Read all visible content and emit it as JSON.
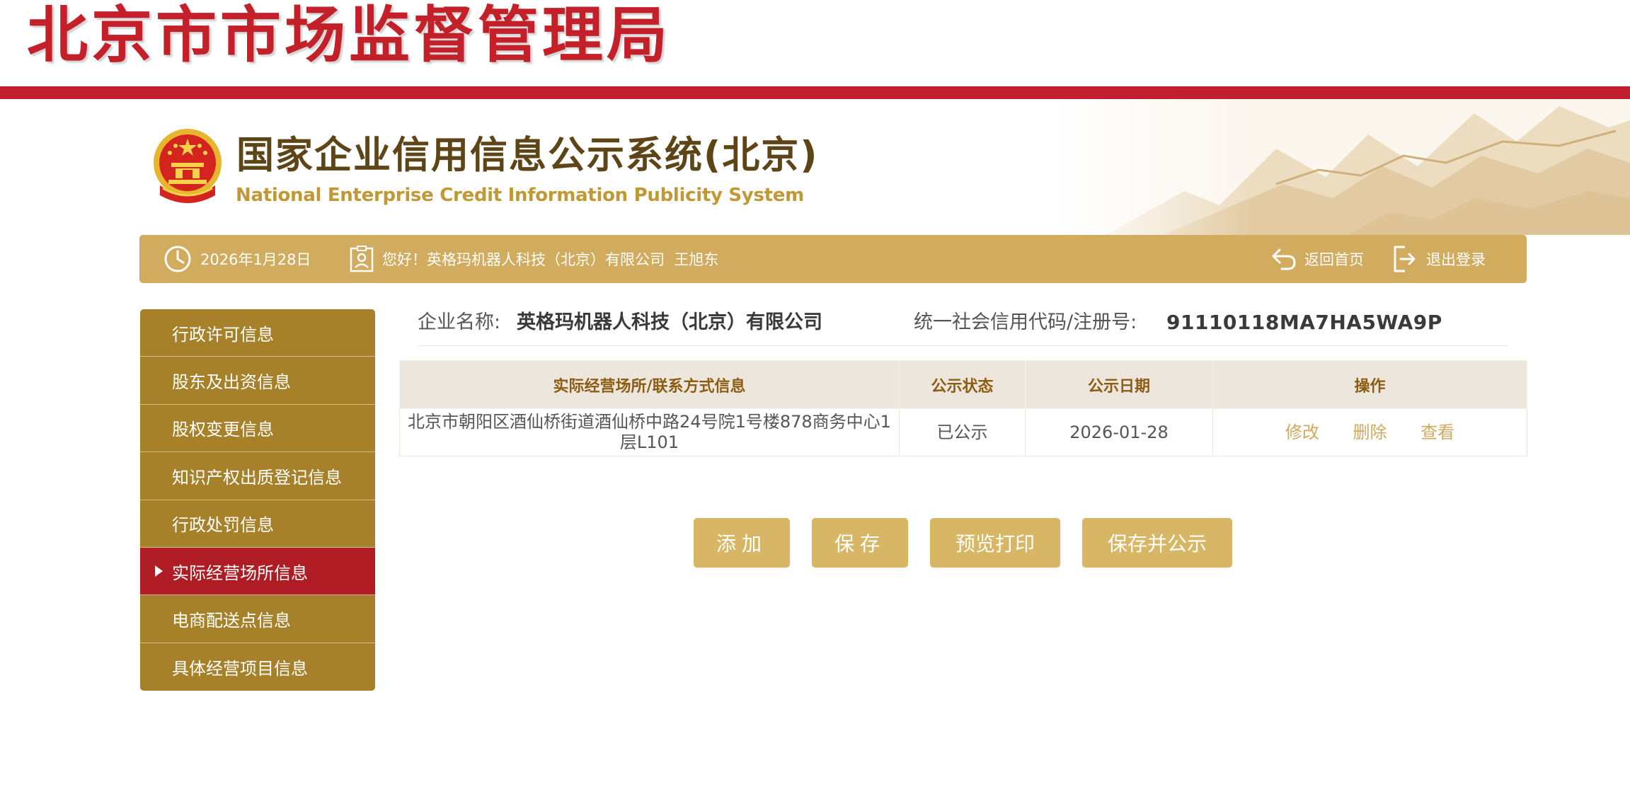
{
  "banner": {
    "title": "北京市市场监督管理局"
  },
  "system": {
    "title_cn": "国家企业信用信息公示系统(北京)",
    "title_en": "National Enterprise Credit Information Publicity System"
  },
  "info_bar": {
    "date": "2026年1月28日",
    "greeting": "您好！英格玛机器人科技（北京）有限公司  王旭东",
    "home_label": "返回首页",
    "logout_label": "退出登录"
  },
  "sidebar": {
    "items": [
      {
        "label": "行政许可信息",
        "active": false
      },
      {
        "label": "股东及出资信息",
        "active": false
      },
      {
        "label": "股权变更信息",
        "active": false
      },
      {
        "label": "知识产权出质登记信息",
        "active": false
      },
      {
        "label": "行政处罚信息",
        "active": false
      },
      {
        "label": "实际经营场所信息",
        "active": true
      },
      {
        "label": "电商配送点信息",
        "active": false
      },
      {
        "label": "具体经营项目信息",
        "active": false
      }
    ]
  },
  "company": {
    "name_label": "企业名称:",
    "name": "英格玛机器人科技（北京）有限公司",
    "credit_label": "统一社会信用代码/注册号:",
    "credit_code": "91110118MA7HA5WA9P"
  },
  "table": {
    "headers": [
      "实际经营场所/联系方式信息",
      "公示状态",
      "公示日期",
      "操作"
    ],
    "rows": [
      {
        "address_line1": "北京市朝阳区酒仙桥街道酒仙桥中路24号院1号楼878商务中心1",
        "address_line2": "层L101",
        "status": "已公示",
        "date": "2026-01-28",
        "actions": [
          "修改",
          "删除",
          "查看"
        ]
      }
    ]
  },
  "buttons": {
    "add": "添加",
    "save": "保存",
    "preview_print": "预览打印",
    "save_publish": "保存并公示"
  },
  "colors": {
    "banner_red": "#c4202a",
    "gold_bar": "#d1ab5e",
    "sidebar_bg": "#a7812a",
    "sidebar_active": "#b01c23",
    "button_gold": "#d7b766",
    "header_brown": "#8b5d12"
  },
  "icons": {
    "date": "clock-icon",
    "greeting": "user-card-icon",
    "home": "return-arrow-icon",
    "logout": "logout-icon",
    "emblem": "national-emblem-icon",
    "active_marker": "triangle-right-icon"
  }
}
